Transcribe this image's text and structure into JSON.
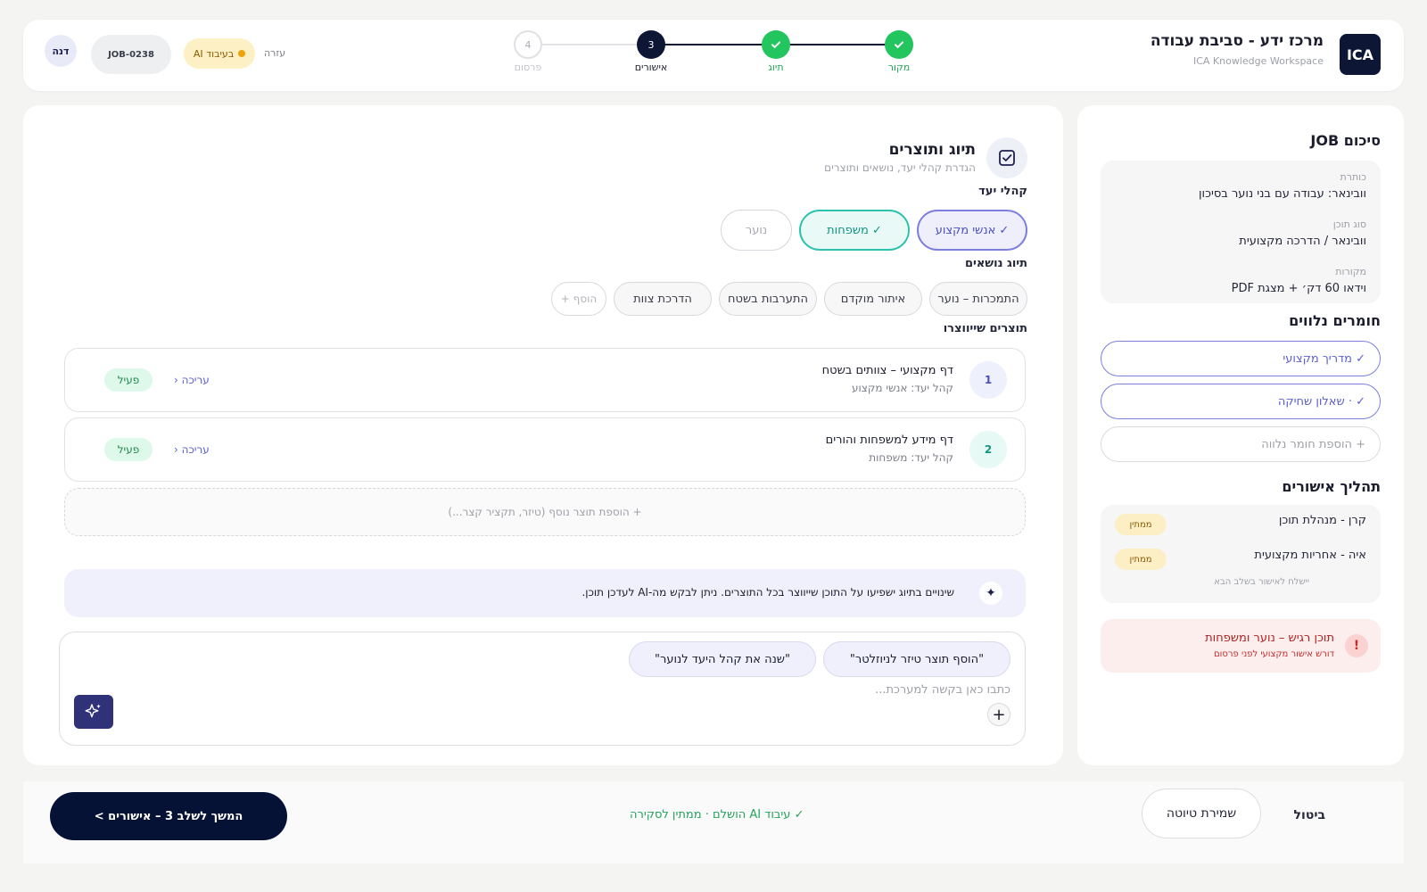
{
  "header": {
    "logo": "ICA",
    "title": "מרכז ידע - סביבת עבודה",
    "subtitle": "ICA Knowledge Workspace",
    "steps": [
      {
        "label": "מקור",
        "state": "done",
        "number": ""
      },
      {
        "label": "תיוג",
        "state": "done",
        "number": ""
      },
      {
        "label": "אישורים",
        "state": "current",
        "number": "3"
      },
      {
        "label": "פרסום",
        "state": "upcoming",
        "number": "4"
      }
    ],
    "help": "עזרה",
    "ai_status": "בעיבוד AI",
    "job_id": "JOB-0238",
    "user": "דנה"
  },
  "main": {
    "title": "תיוג ותוצרים",
    "subtitle": "הגדרת קהלי יעד, נושאים ותוצרים",
    "audience_label": "קהלי יעד",
    "audiences": [
      {
        "label": "✓ אנשי מקצוע",
        "selected": true
      },
      {
        "label": "✓ משפחות",
        "selected": true
      },
      {
        "label": "נוער",
        "selected": false
      }
    ],
    "topics_label": "תיוג נושאים",
    "topics": [
      "התמכרות – נוער",
      "איתור מוקדם",
      "התערבות בשטח",
      "הדרכת צוות"
    ],
    "add_topic": "+ הוסף",
    "products_label": "תוצרים שייווצרו",
    "products": [
      {
        "number": "1",
        "title": "דף מקצועי – צוותים בשטח",
        "audience": "קהל יעד: אנשי מקצוע",
        "edit": "עריכה ‹",
        "status": "פעיל"
      },
      {
        "number": "2",
        "title": "דף מידע למשפחות והורים",
        "audience": "קהל יעד: משפחות",
        "edit": "עריכה ‹",
        "status": "פעיל"
      }
    ],
    "add_product": "+ הוספת תוצר נוסף (טיזר, תקציר קצר...)",
    "info": "שינויים בתיוג ישפיעו על התוכן שייווצר בכל התוצרים. ניתן לבקש מה-AI לעדכן תוכן.",
    "suggestions": [
      "\"הוסף תוצר טיזר לניוזלטר\"",
      "\"שנה את קהל היעד לנוער\""
    ],
    "composer_placeholder": "כתבו כאן בקשה למערכת..."
  },
  "side": {
    "summary_title": "סיכום JOB",
    "summary": [
      {
        "label": "כותרת",
        "value": "וובינאר: עבודה עם בני נוער בסיכון"
      },
      {
        "label": "סוג תוכן",
        "value": "וובינאר / הדרכה מקצועית"
      },
      {
        "label": "מקורות",
        "value": "וידאו 60 דק׳ + מצגת PDF"
      }
    ],
    "materials_title": "חומרים נלווים",
    "materials": [
      "✓ מדריך מקצועי",
      "✓ · שאלון שחיקה"
    ],
    "add_material": "+ הוספת חומר נלווה",
    "approvals_title": "תהליך אישורים",
    "approvals": [
      {
        "name": "קרן - מנהלת תוכן",
        "status": "ממתין"
      },
      {
        "name": "איה - אחריות מקצועית",
        "status": "ממתין"
      }
    ],
    "approvals_note": "יישלח לאישור בשלב הבא",
    "alert_title": "תוכן רגיש – נוער ומשפחות",
    "alert_sub": "דורש אישור מקצועי לפני פרסום"
  },
  "footer": {
    "cancel": "ביטול",
    "save_draft": "שמירת טיוטה",
    "status": "✓ עיבוד AI הושלם · ממתין לסקירה",
    "next": "המשך לשלב 3 – אישורים >"
  },
  "colors": {
    "navy": "#061235",
    "green": "#22c55e",
    "purple": "#5b5fcf",
    "teal": "#14b8a6"
  }
}
